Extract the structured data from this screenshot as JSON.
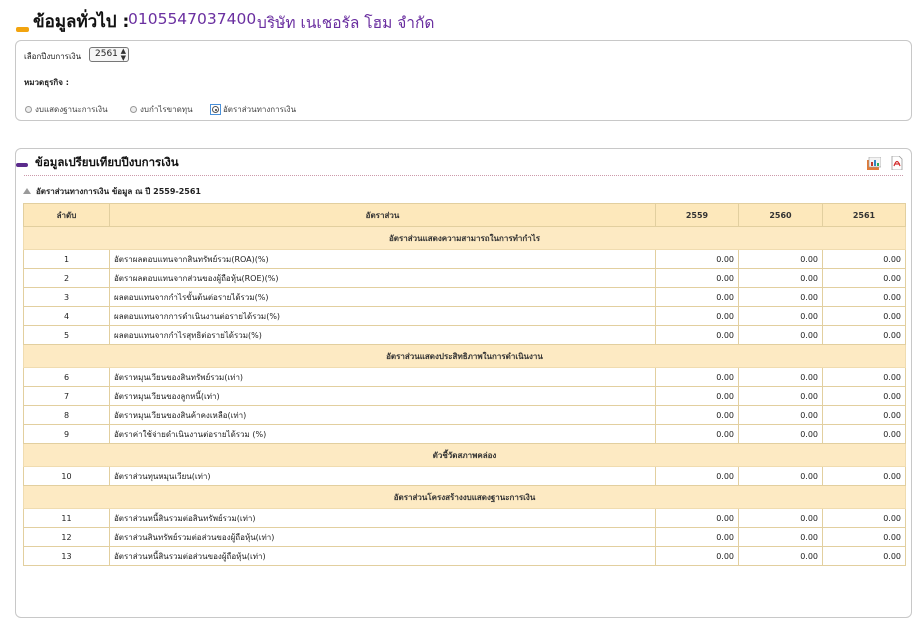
{
  "header": {
    "label": "ข้อมูลทั่วไป :",
    "company_id": "0105547037400",
    "company_name": "บริษัท เนเชอรัล โฮม จำกัด"
  },
  "filter": {
    "fiscal_year_label": "เลือกปีงบการเงิน",
    "fiscal_year_value": "2561",
    "category_label": "หมวดธุรกิจ :",
    "options": [
      {
        "label": "งบแสดงฐานะการเงิน",
        "selected": false
      },
      {
        "label": "งบกำไรขาดทุน",
        "selected": false
      },
      {
        "label": "อัตราส่วนทางการเงิน",
        "selected": true
      }
    ]
  },
  "compare": {
    "title": "ข้อมูลเปรียบเทียบปีงบการเงิน",
    "subtitle": "อัตราส่วนทางการเงิน ข้อมูล ณ ปี 2559-2561",
    "icons": [
      "excel-export-icon",
      "pdf-export-icon"
    ],
    "table": {
      "headers": [
        "ลำดับ",
        "อัตราส่วน",
        "2559",
        "2560",
        "2561"
      ],
      "sections": [
        {
          "title": "อัตราส่วนแสดงความสามารถในการทำกำไร",
          "rows": [
            {
              "no": "1",
              "name": "อัตราผลตอบแทนจากสินทรัพย์รวม(ROA)(%)",
              "v1": "0.00",
              "v2": "0.00",
              "v3": "0.00"
            },
            {
              "no": "2",
              "name": "อัตราผลตอบแทนจากส่วนของผู้ถือหุ้น(ROE)(%)",
              "v1": "0.00",
              "v2": "0.00",
              "v3": "0.00"
            },
            {
              "no": "3",
              "name": "ผลตอบแทนจากกำไรขั้นต้นต่อรายได้รวม(%)",
              "v1": "0.00",
              "v2": "0.00",
              "v3": "0.00"
            },
            {
              "no": "4",
              "name": "ผลตอบแทนจากการดำเนินงานต่อรายได้รวม(%)",
              "v1": "0.00",
              "v2": "0.00",
              "v3": "0.00"
            },
            {
              "no": "5",
              "name": "ผลตอบแทนจากกำไรสุทธิต่อรายได้รวม(%)",
              "v1": "0.00",
              "v2": "0.00",
              "v3": "0.00"
            }
          ]
        },
        {
          "title": "อัตราส่วนแสดงประสิทธิภาพในการดำเนินงาน",
          "rows": [
            {
              "no": "6",
              "name": "อัตราหมุนเวียนของสินทรัพย์รวม(เท่า)",
              "v1": "0.00",
              "v2": "0.00",
              "v3": "0.00"
            },
            {
              "no": "7",
              "name": "อัตราหมุนเวียนของลูกหนี้(เท่า)",
              "v1": "0.00",
              "v2": "0.00",
              "v3": "0.00"
            },
            {
              "no": "8",
              "name": "อัตราหมุนเวียนของสินค้าคงเหลือ(เท่า)",
              "v1": "0.00",
              "v2": "0.00",
              "v3": "0.00"
            },
            {
              "no": "9",
              "name": "อัตราค่าใช้จ่ายดำเนินงานต่อรายได้รวม (%)",
              "v1": "0.00",
              "v2": "0.00",
              "v3": "0.00"
            }
          ]
        },
        {
          "title": "ตัวชี้วัดสภาพคล่อง",
          "rows": [
            {
              "no": "10",
              "name": "อัตราส่วนทุนหมุนเวียน(เท่า)",
              "v1": "0.00",
              "v2": "0.00",
              "v3": "0.00"
            }
          ]
        },
        {
          "title": "อัตราส่วนโครงสร้างงบแสดงฐานะการเงิน",
          "rows": [
            {
              "no": "11",
              "name": "อัตราส่วนหนี้สินรวมต่อสินทรัพย์รวม(เท่า)",
              "v1": "0.00",
              "v2": "0.00",
              "v3": "0.00"
            },
            {
              "no": "12",
              "name": "อัตราส่วนสินทรัพย์รวมต่อส่วนของผู้ถือหุ้น(เท่า)",
              "v1": "0.00",
              "v2": "0.00",
              "v3": "0.00"
            },
            {
              "no": "13",
              "name": "อัตราส่วนหนี้สินรวมต่อส่วนของผู้ถือหุ้น(เท่า)",
              "v1": "0.00",
              "v2": "0.00",
              "v3": "0.00"
            }
          ]
        }
      ]
    }
  }
}
